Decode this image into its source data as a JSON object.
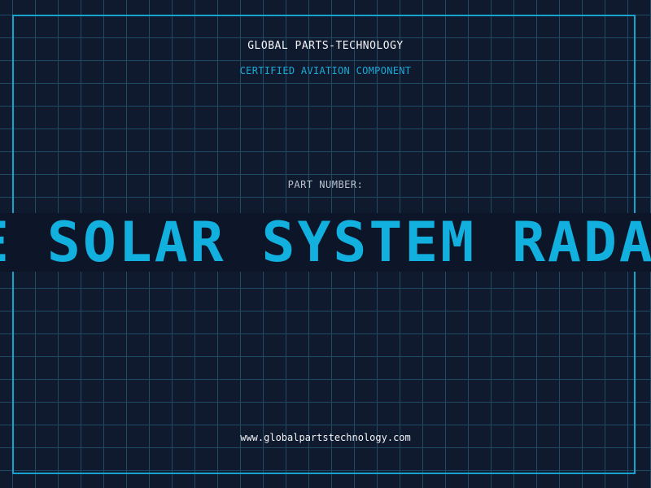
{
  "header": {
    "company": "GLOBAL PARTS-TECHNOLOGY",
    "subtitle": "CERTIFIED AVIATION COMPONENT"
  },
  "part": {
    "label": "PART NUMBER:",
    "value": "E SOLAR SYSTEM RADA"
  },
  "footer": {
    "url": "www.globalpartstechnology.com"
  },
  "colors": {
    "background": "#101a2e",
    "grid": "#1f4a63",
    "accent": "#18a3cf",
    "text": "#f2f4f7"
  }
}
